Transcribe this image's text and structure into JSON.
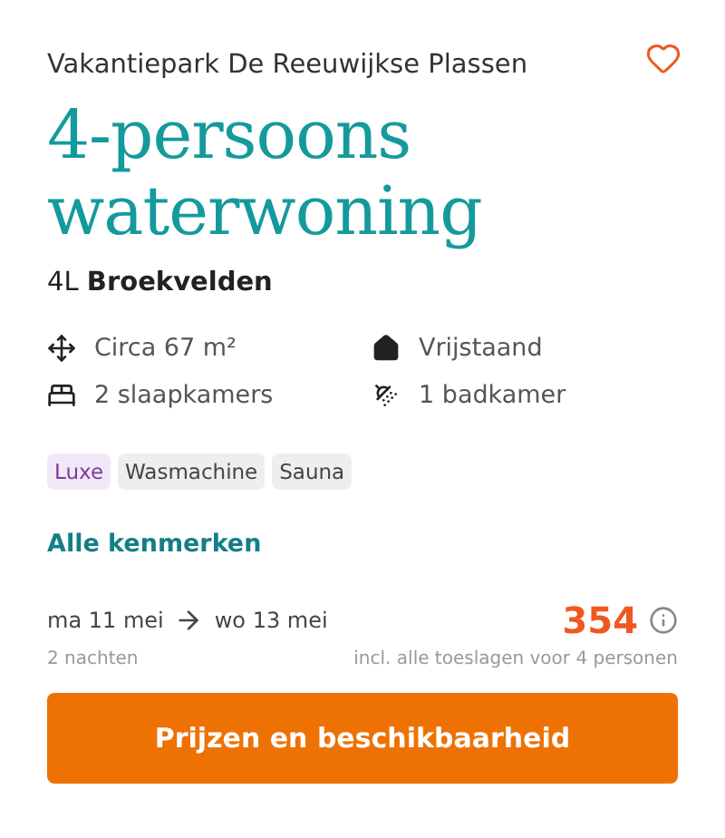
{
  "park": "Vakantiepark De Reeuwijkse Plassen",
  "favorite": false,
  "title": "4-persoons waterwoning",
  "subtitle": "4L **Broekvelden**",
  "features": [
    {
      "kind": "area",
      "text": "Circa 67 m²"
    },
    {
      "kind": "house",
      "text": "Vrijstaand"
    },
    {
      "kind": "bed",
      "text": "2 slaapkamers"
    },
    {
      "kind": "shower",
      "text": "1 badkamer"
    }
  ],
  "tags": [
    {
      "kind": "premium",
      "label": "Luxe"
    },
    {
      "kind": "regular",
      "label": "Wasmachine"
    },
    {
      "kind": "regular",
      "label": "Sauna"
    }
  ],
  "link": "Alle kenmerken",
  "dates": {
    "from": "ma 11 mei",
    "to": "wo 13 mei",
    "nights": "2 nachten"
  },
  "price": {
    "amount": "354",
    "note": "incl. alle toeslagen voor 4 personen"
  },
  "button": "Prijzen en beschikbaarheid"
}
